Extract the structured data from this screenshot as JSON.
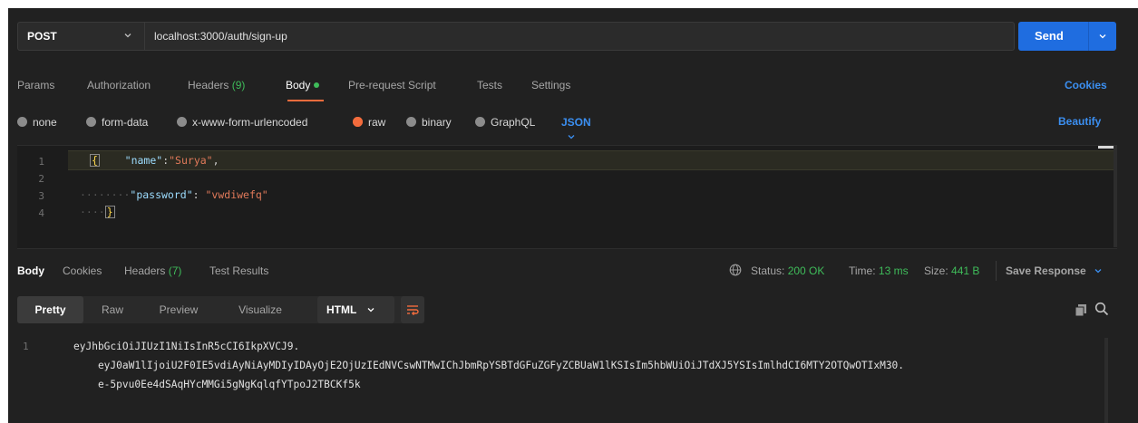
{
  "request": {
    "method": "POST",
    "url": "localhost:3000/auth/sign-up",
    "send_label": "Send"
  },
  "request_tabs": {
    "params": "Params",
    "authorization": "Authorization",
    "headers": "Headers",
    "headers_count": "(9)",
    "body": "Body",
    "pre_request": "Pre-request Script",
    "tests": "Tests",
    "settings": "Settings",
    "cookies": "Cookies"
  },
  "body_types": {
    "none": "none",
    "form_data": "form-data",
    "urlencoded": "x-www-form-urlencoded",
    "raw": "raw",
    "binary": "binary",
    "graphql": "GraphQL",
    "selected_format": "JSON",
    "beautify": "Beautify"
  },
  "editor": {
    "line_numbers": [
      "1",
      "2",
      "3",
      "4"
    ],
    "open_brace": "{",
    "close_brace": "}",
    "name_key": "\"name\"",
    "name_sep": ":",
    "name_value": "\"Surya\"",
    "name_comma": ",",
    "password_key": "\"password\"",
    "password_sep": ": ",
    "password_value": "\"vwdiwefq\""
  },
  "response_tabs": {
    "body": "Body",
    "cookies": "Cookies",
    "headers": "Headers",
    "headers_count": "(7)",
    "test_results": "Test Results"
  },
  "response_status": {
    "status_label": "Status:",
    "status_value": "200 OK",
    "time_label": "Time:",
    "time_value": "13 ms",
    "size_label": "Size:",
    "size_value": "441 B",
    "save_response": "Save Response"
  },
  "response_view": {
    "pretty": "Pretty",
    "raw": "Raw",
    "preview": "Preview",
    "visualize": "Visualize",
    "format": "HTML"
  },
  "response_body": {
    "line_number": "1",
    "lines": [
      "eyJhbGciOiJIUzI1NiIsInR5cCI6IkpXVCJ9.",
      "    eyJ0aW1lIjoiU2F0IE5vdiAyNiAyMDIyIDAyOjE2OjUzIEdNVCswNTMwIChJbmRpYSBTdGFuZGFyZCBUaW1lKSIsIm5hbWUiOiJTdXJ5YSIsImlhdCI6MTY2OTQwOTIxM30.",
      "    e-5pvu0Ee4dSAqHYcMMGi5gNgKqlqfYTpoJ2TBCKf5k"
    ]
  },
  "colors": {
    "accent_blue": "#1f6de0",
    "link_blue": "#3b8ff1",
    "success_green": "#3fbc5a",
    "orange": "#f36c3d",
    "background": "#212121"
  }
}
